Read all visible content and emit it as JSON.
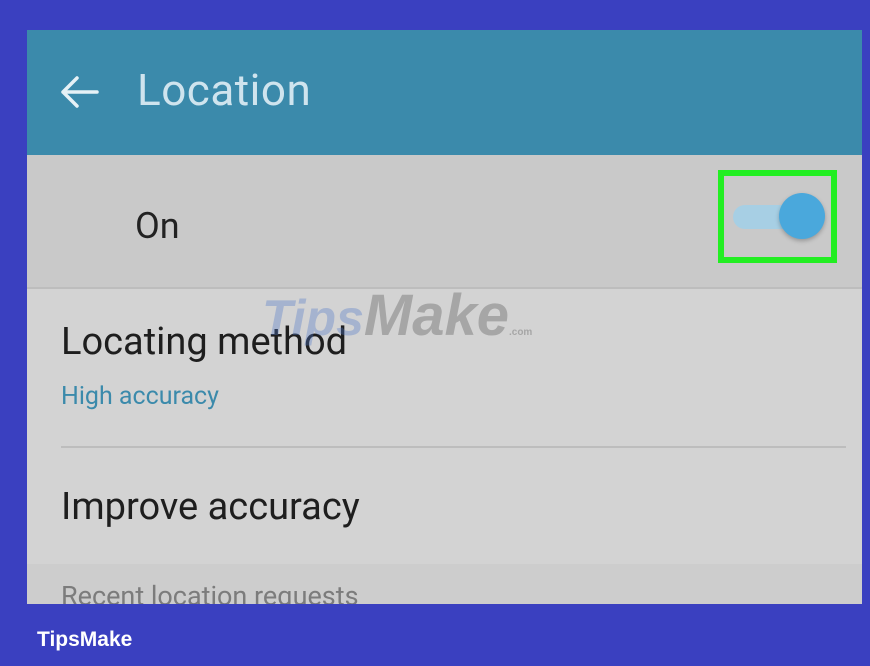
{
  "toolbar": {
    "title": "Location",
    "back_icon": "arrow-back-icon"
  },
  "master_switch": {
    "label": "On",
    "state": "on",
    "track_color": "#a7cfe4",
    "thumb_color": "#4aa8dc",
    "highlight_color": "#22ee22"
  },
  "settings": {
    "locating_method": {
      "title": "Locating method",
      "value": "High accuracy"
    },
    "improve_accuracy": {
      "title": "Improve accuracy"
    }
  },
  "section": {
    "recent_requests": "Recent location requests"
  },
  "watermark": {
    "tips": "Tips",
    "make": "Make",
    "com": ".com"
  },
  "footer": {
    "brand": "TipsMake"
  },
  "colors": {
    "toolbar": "#3b8aab",
    "frame": "#3a40c0",
    "accent_text": "#3b8aab"
  }
}
